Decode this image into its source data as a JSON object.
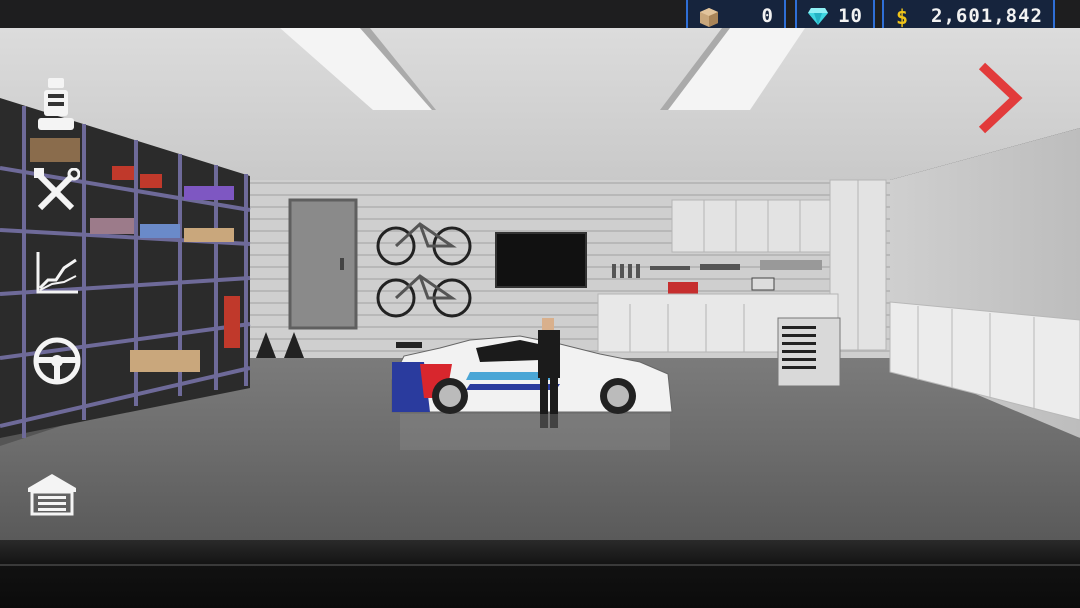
{
  "hud": {
    "crates": {
      "icon": "crate-icon",
      "value": "0"
    },
    "diamonds": {
      "icon": "diamond-icon",
      "value": "10"
    },
    "cash": {
      "icon": "dollar-icon",
      "value": "2,601,842"
    }
  },
  "side_menu": [
    {
      "icon": "seat-icon"
    },
    {
      "icon": "tools-icon"
    },
    {
      "icon": "performance-chart-icon"
    },
    {
      "icon": "steering-wheel-icon"
    },
    {
      "icon": "garage-icon"
    }
  ],
  "navigation": {
    "next_icon": "chevron-right-icon"
  },
  "colors": {
    "accent_blue": "#2f6fd6",
    "next_arrow": "#e23b3b",
    "diamond": "#3fd6e0",
    "dollar": "#f0c419"
  }
}
